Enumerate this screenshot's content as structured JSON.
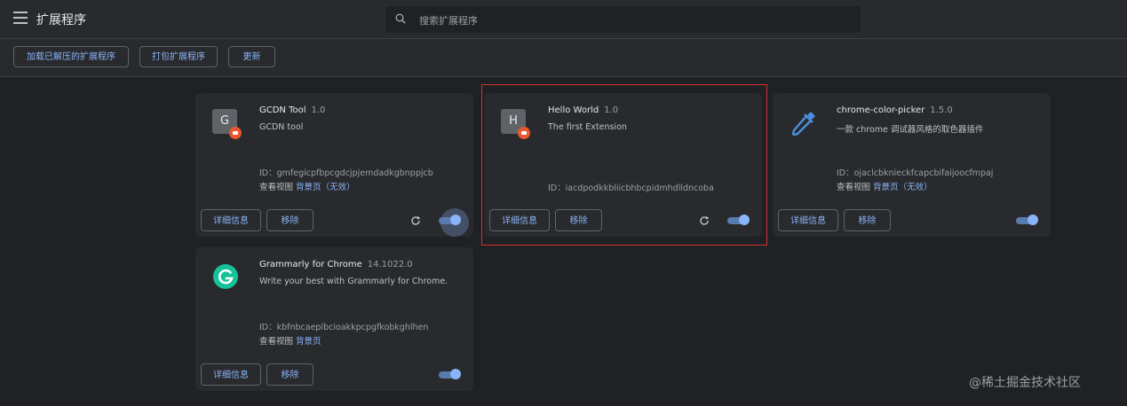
{
  "header": {
    "title": "扩展程序",
    "search_placeholder": "搜索扩展程序"
  },
  "toolbar": {
    "load_unpacked": "加载已解压的扩展程序",
    "pack": "打包扩展程序",
    "update": "更新"
  },
  "common": {
    "details": "详细信息",
    "remove": "移除"
  },
  "extensions": [
    {
      "name": "GCDN Tool",
      "version": "1.0",
      "description": "GCDN tool",
      "id": "ID：gmfegicpfbpcgdcjpjemdadkgbnppjcb",
      "views_label": "查看视图",
      "views_link": "背景页",
      "views_status": "（无效）",
      "icon_letter": "G",
      "enabled": true
    },
    {
      "name": "Hello World",
      "version": "1.0",
      "description": "The first Extension",
      "id": "ID：iacdpodkkbliicbhbcpidmhdlldncoba",
      "icon_letter": "H",
      "enabled": true
    },
    {
      "name": "chrome-color-picker",
      "version": "1.5.0",
      "description": "一款 chrome 调试器风格的取色器插件",
      "id": "ID：ojaclcbknieckfcapcbifaijoocfmpaj",
      "views_label": "查看视图",
      "views_link": "背景页",
      "views_status": "（无效）",
      "icon": "eyedropper-icon",
      "enabled": true
    },
    {
      "name": "Grammarly for Chrome",
      "version": "14.1022.0",
      "description": "Write your best with Grammarly for Chrome.",
      "id": "ID：kbfnbcaeplbcioakkpcpgfkobkghlhen",
      "views_label": "查看视图",
      "views_link": "背景页",
      "icon": "grammarly-icon",
      "enabled": true
    }
  ],
  "watermark": "@稀土掘金技术社区",
  "colors": {
    "background": "#202124",
    "surface": "#292a2d",
    "accent": "#8ab4f8",
    "highlight": "#d32f2f",
    "grammarly": "#15c39a",
    "badge": "#e8572f"
  }
}
